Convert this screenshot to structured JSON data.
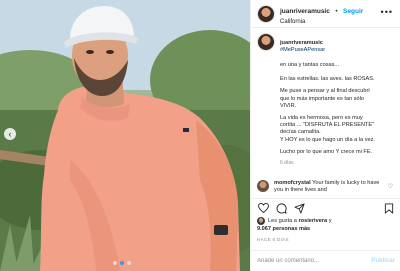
{
  "post": {
    "username": "juanriveramusic",
    "separator": "•",
    "follow_label": "Seguir",
    "location": "California",
    "more_label": "•••"
  },
  "caption": {
    "username": "juanriveramusic",
    "hashtag": "#MePuseAPensar",
    "line1": "en una y tantas cosas...",
    "line2": "En las estrellas. las aves. las ROSAS.",
    "para2": "Me puse a pensar y al final descubrí\nque lo más importante es tan sólo\nVIVIR.",
    "para3": "La vida es hermosa, pero es muy\ncortita ... \"DISFRUTA EL PRESENTE\"\ndecías carnalita.\nY HOY es lo que hago un día a la vez.",
    "para4": "Lucho por lo que amo Y crece mi FE.",
    "time": "6 días"
  },
  "comment": {
    "username": "momofcrystal",
    "text": "Your family is lucky to have you in there lives and"
  },
  "likes": {
    "liked_by_prefix": "Les gusta a",
    "liked_by_user": "rosierivera",
    "liked_by_suffix": "y",
    "count_text": "9.067 personas más",
    "date": "HACE 6 DÍAS"
  },
  "add_comment": {
    "placeholder": "Añade un comentario...",
    "publish_label": "Publicar"
  },
  "photo": {
    "prev_arrow": "‹"
  },
  "icons": {
    "heart": "heart-icon",
    "comment": "comment-icon",
    "share": "share-icon",
    "save": "bookmark-icon"
  },
  "colors": {
    "accent": "#0095f6",
    "hashtag": "#00376b",
    "muted": "#8e8e8e",
    "shirt": "#f2a088",
    "cap": "#f3f5f7"
  }
}
